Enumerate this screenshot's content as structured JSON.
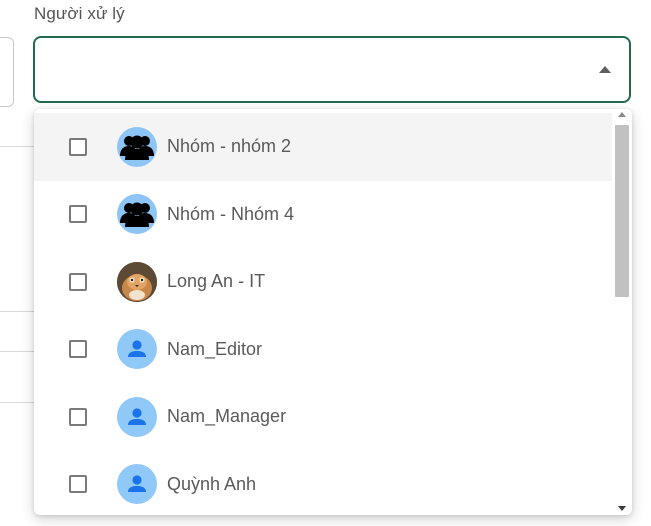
{
  "field": {
    "label": "Người xử lý",
    "value": ""
  },
  "dropdown": {
    "items": [
      {
        "label": "Nhóm - nhóm 2",
        "avatar": "group-icon",
        "checked": false
      },
      {
        "label": "Nhóm - Nhóm 4",
        "avatar": "group-icon",
        "checked": false
      },
      {
        "label": "Long An - IT",
        "avatar": "photo-avatar",
        "checked": false
      },
      {
        "label": "Nam_Editor",
        "avatar": "person-icon",
        "checked": false
      },
      {
        "label": "Nam_Manager",
        "avatar": "person-icon",
        "checked": false
      },
      {
        "label": "Quỳnh Anh",
        "avatar": "person-icon",
        "checked": false
      }
    ]
  },
  "colors": {
    "focus_border": "#1f6b4c",
    "avatar_bg": "#90c8f8",
    "label_text": "#555555"
  }
}
